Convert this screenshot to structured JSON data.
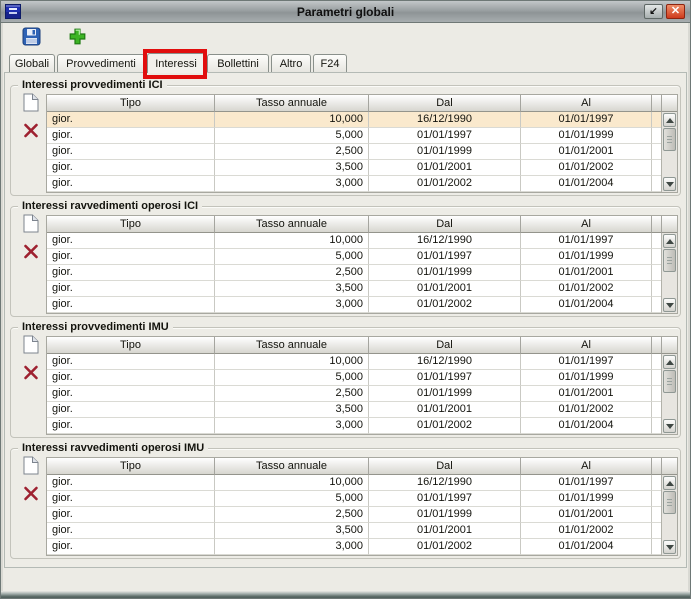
{
  "window": {
    "title": "Parametri globali",
    "controls": {
      "restore_glyph": "↙",
      "close_glyph": "✕"
    }
  },
  "toolbar": {
    "save_icon": "floppy-disk",
    "add_icon": "green-plus"
  },
  "tabs": {
    "items": [
      {
        "label": "Globali"
      },
      {
        "label": "Provvedimenti"
      },
      {
        "label": "Interessi",
        "annotated": true
      },
      {
        "label": "Bollettini"
      },
      {
        "label": "Altro"
      },
      {
        "label": "F24"
      }
    ]
  },
  "sections": [
    {
      "title": "Interessi provvedimenti ICI",
      "selected_row": 0,
      "columns": [
        "Tipo",
        "Tasso annuale",
        "Dal",
        "Al"
      ],
      "rows": [
        [
          "gior.",
          "10,000",
          "16/12/1990",
          "01/01/1997"
        ],
        [
          "gior.",
          "5,000",
          "01/01/1997",
          "01/01/1999"
        ],
        [
          "gior.",
          "2,500",
          "01/01/1999",
          "01/01/2001"
        ],
        [
          "gior.",
          "3,500",
          "01/01/2001",
          "01/01/2002"
        ],
        [
          "gior.",
          "3,000",
          "01/01/2002",
          "01/01/2004"
        ]
      ]
    },
    {
      "title": "Interessi ravvedimenti operosi ICI",
      "selected_row": null,
      "columns": [
        "Tipo",
        "Tasso annuale",
        "Dal",
        "Al"
      ],
      "rows": [
        [
          "gior.",
          "10,000",
          "16/12/1990",
          "01/01/1997"
        ],
        [
          "gior.",
          "5,000",
          "01/01/1997",
          "01/01/1999"
        ],
        [
          "gior.",
          "2,500",
          "01/01/1999",
          "01/01/2001"
        ],
        [
          "gior.",
          "3,500",
          "01/01/2001",
          "01/01/2002"
        ],
        [
          "gior.",
          "3,000",
          "01/01/2002",
          "01/01/2004"
        ]
      ]
    },
    {
      "title": "Interessi provvedimenti IMU",
      "selected_row": null,
      "columns": [
        "Tipo",
        "Tasso annuale",
        "Dal",
        "Al"
      ],
      "rows": [
        [
          "gior.",
          "10,000",
          "16/12/1990",
          "01/01/1997"
        ],
        [
          "gior.",
          "5,000",
          "01/01/1997",
          "01/01/1999"
        ],
        [
          "gior.",
          "2,500",
          "01/01/1999",
          "01/01/2001"
        ],
        [
          "gior.",
          "3,500",
          "01/01/2001",
          "01/01/2002"
        ],
        [
          "gior.",
          "3,000",
          "01/01/2002",
          "01/01/2004"
        ]
      ]
    },
    {
      "title": "Interessi ravvedimenti operosi IMU",
      "selected_row": null,
      "columns": [
        "Tipo",
        "Tasso annuale",
        "Dal",
        "Al"
      ],
      "rows": [
        [
          "gior.",
          "10,000",
          "16/12/1990",
          "01/01/1997"
        ],
        [
          "gior.",
          "5,000",
          "01/01/1997",
          "01/01/1999"
        ],
        [
          "gior.",
          "2,500",
          "01/01/1999",
          "01/01/2001"
        ],
        [
          "gior.",
          "3,500",
          "01/01/2001",
          "01/01/2002"
        ],
        [
          "gior.",
          "3,000",
          "01/01/2002",
          "01/01/2004"
        ]
      ]
    }
  ],
  "colors": {
    "annotation": "#E10E0E",
    "selected_row_bg": "#FAE9CD",
    "titlebar": "#9AA0A2",
    "close_button": "#CE3B1D",
    "save_icon_blue": "#2E62B5",
    "add_icon_green": "#3DB424",
    "delete_icon_red": "#9E2130",
    "panel_bg": "#EDECE6"
  }
}
